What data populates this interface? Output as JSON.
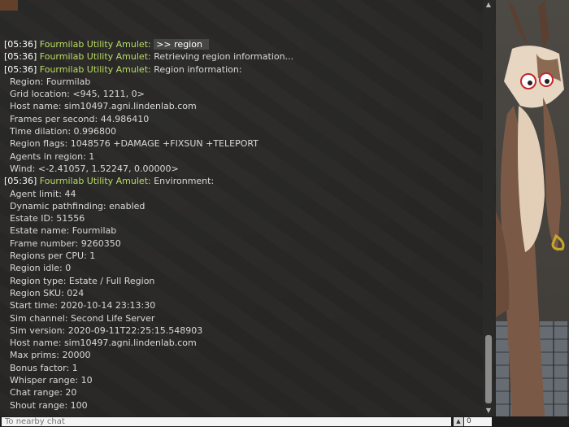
{
  "chat": {
    "lines": [
      {
        "ts": "[05:36]",
        "src": "Fourmilab Utility Amulet:",
        "msg": ">> region"
      },
      {
        "ts": "[05:36]",
        "src": "Fourmilab Utility Amulet:",
        "msg": "Retrieving region information..."
      },
      {
        "ts": "[05:36]",
        "src": "Fourmilab Utility Amulet:",
        "msg": "Region information:"
      },
      {
        "text": "Region: Fourmilab"
      },
      {
        "text": "Grid location: <945, 1211, 0>"
      },
      {
        "text": "Host name: sim10497.agni.lindenlab.com"
      },
      {
        "text": "Frames per second: 44.986410"
      },
      {
        "text": "Time dilation: 0.996800"
      },
      {
        "text": "Region flags: 1048576 +DAMAGE +FIXSUN +TELEPORT"
      },
      {
        "text": "Agents in region: 1"
      },
      {
        "text": "Wind: <-2.41057, 1.52247, 0.00000>"
      },
      {
        "ts": "[05:36]",
        "src": "Fourmilab Utility Amulet:",
        "msg": "  Environment:"
      },
      {
        "text": "Agent limit: 44"
      },
      {
        "text": "Dynamic pathfinding: enabled"
      },
      {
        "text": "Estate ID: 51556"
      },
      {
        "text": "Estate name: Fourmilab"
      },
      {
        "text": "Frame number: 9260350"
      },
      {
        "text": "Regions per CPU: 1"
      },
      {
        "text": "Region idle: 0"
      },
      {
        "text": "Region type: Estate / Full Region"
      },
      {
        "text": "Region SKU: 024"
      },
      {
        "text": "Start time: 2020-10-14 23:13:30"
      },
      {
        "text": "Sim channel: Second Life Server"
      },
      {
        "text": "Sim version: 2020-09-11T22:25:15.548903"
      },
      {
        "text": "Host name: sim10497.agni.lindenlab.com"
      },
      {
        "text": "Max prims: 20000"
      },
      {
        "text": "Bonus factor: 1"
      },
      {
        "text": "Whisper range: 10"
      },
      {
        "text": "Chat range: 20"
      },
      {
        "text": "Shout range: 100"
      }
    ]
  },
  "input": {
    "placeholder": "To nearby chat",
    "channel": "0"
  },
  "icons": {
    "scroll_up": "scroll-up-arrow-icon",
    "scroll_down": "scroll-down-arrow-icon",
    "spinner_up": "spinner-up-arrow-icon"
  },
  "colors": {
    "timestamp": "#ffffff",
    "sender": "#b8dd62",
    "message": "#d9d9d9"
  }
}
